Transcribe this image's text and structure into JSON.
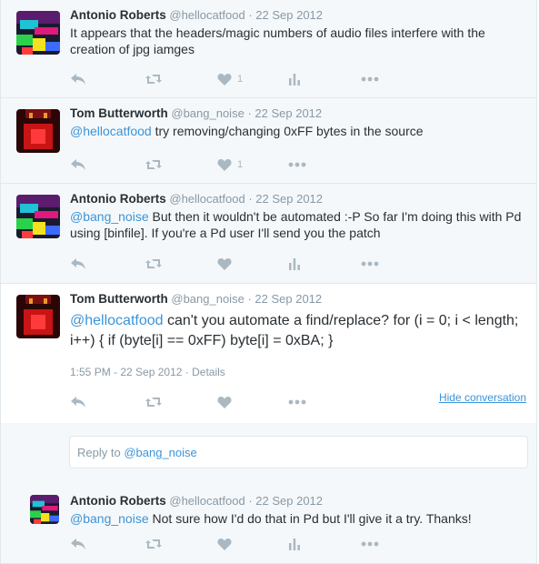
{
  "tweets": [
    {
      "name": "Antonio Roberts",
      "handle": "@hellocatfood",
      "sep": "·",
      "date": "22 Sep 2012",
      "mention": "",
      "text": "It appears that the headers/magic numbers of audio files interfere with the creation of jpg iamges",
      "likes": "1"
    },
    {
      "name": "Tom Butterworth",
      "handle": "@bang_noise",
      "sep": "·",
      "date": "22 Sep 2012",
      "mention": "@hellocatfood",
      "text": " try removing/changing 0xFF bytes in the source",
      "likes": "1"
    },
    {
      "name": "Antonio Roberts",
      "handle": "@hellocatfood",
      "sep": "·",
      "date": "22 Sep 2012",
      "mention": "@bang_noise",
      "text": " But then it wouldn't be automated :-P So far I'm doing this with Pd using [binfile]. If you're a Pd user I'll send you the patch",
      "likes": ""
    },
    {
      "name": "Tom Butterworth",
      "handle": "@bang_noise",
      "sep": "·",
      "date": "22 Sep 2012",
      "mention": "@hellocatfood",
      "text": " can't you automate a find/replace? for (i = 0; i < length; i++) { if (byte[i] == 0xFF) byte[i] = 0xBA; }",
      "timestamp": "1:55 PM - 22 Sep 2012",
      "details": "Details",
      "hide": "Hide conversation"
    },
    {
      "name": "Antonio Roberts",
      "handle": "@hellocatfood",
      "sep": "·",
      "date": "22 Sep 2012",
      "mention": "@bang_noise",
      "text": " Not sure how I'd do that in Pd but I'll give it a try. Thanks!",
      "likes": ""
    }
  ],
  "reply": {
    "prefix": "Reply to ",
    "mention": "@bang_noise"
  },
  "icons": [
    "reply-icon",
    "retweet-icon",
    "heart-icon",
    "analytics-icon",
    "more-icon"
  ],
  "colors": {
    "link": "#3b94d9",
    "muted_text": "#8899a6",
    "icon": "#aab8c2",
    "border": "#e1e8ed",
    "muted_bg": "#f5f8fa"
  }
}
